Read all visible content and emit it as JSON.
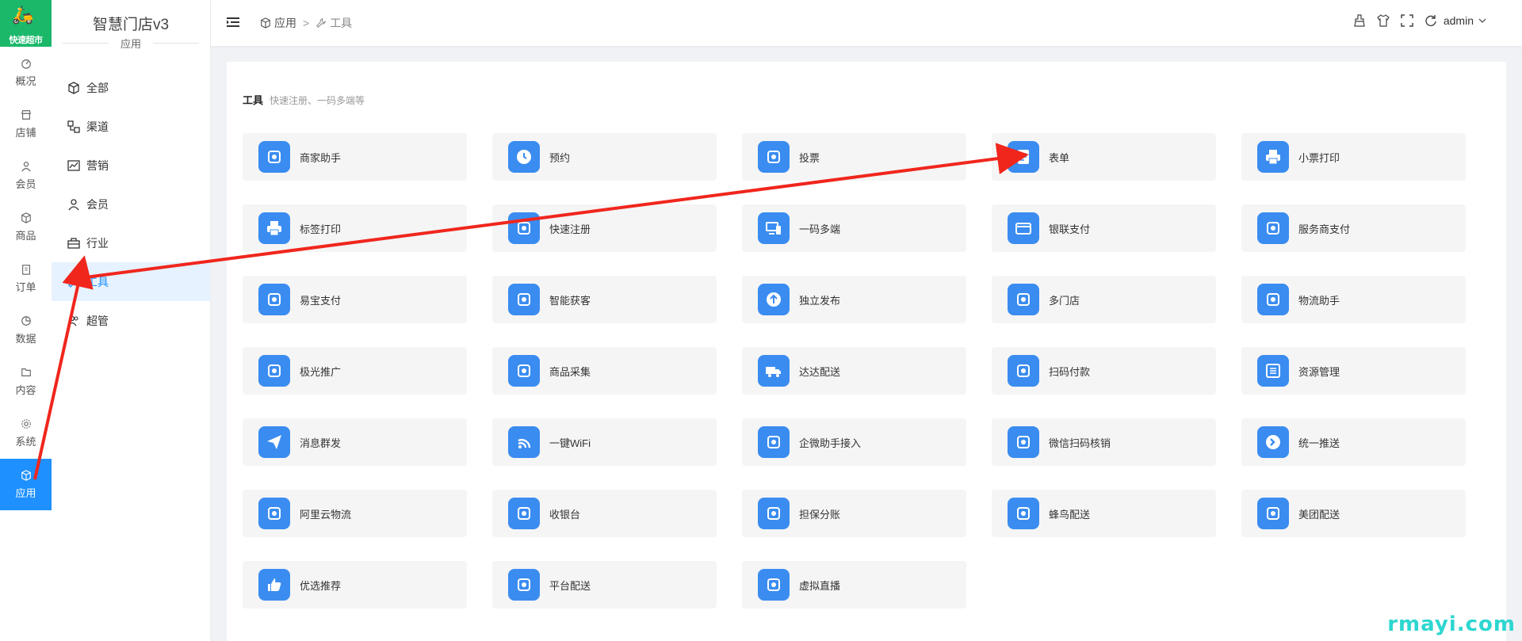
{
  "logo": {
    "mark": "🛵",
    "text": "快速超市"
  },
  "rail": [
    {
      "label": "概况",
      "icon": "dashboard-icon"
    },
    {
      "label": "店铺",
      "icon": "shop-icon"
    },
    {
      "label": "会员",
      "icon": "user-icon"
    },
    {
      "label": "商品",
      "icon": "box-icon"
    },
    {
      "label": "订单",
      "icon": "clipboard-icon"
    },
    {
      "label": "数据",
      "icon": "pie-icon"
    },
    {
      "label": "内容",
      "icon": "folder-icon"
    },
    {
      "label": "系统",
      "icon": "gear-icon"
    },
    {
      "label": "应用",
      "icon": "cube-icon",
      "active": true
    }
  ],
  "sidebar": {
    "title": "智慧门店v3",
    "subtitle": "应用",
    "items": [
      {
        "label": "全部",
        "icon": "cube-icon"
      },
      {
        "label": "渠道",
        "icon": "channel-icon"
      },
      {
        "label": "营销",
        "icon": "chart-icon"
      },
      {
        "label": "会员",
        "icon": "user-icon"
      },
      {
        "label": "行业",
        "icon": "briefcase-icon"
      },
      {
        "label": "工具",
        "icon": "wrench-icon",
        "active": true
      },
      {
        "label": "超管",
        "icon": "users-icon"
      }
    ]
  },
  "header": {
    "breadcrumb": [
      "应用",
      "工具"
    ],
    "breadcrumb_sep": ">",
    "user": "admin"
  },
  "content": {
    "title": "工具",
    "subtitle": "快速注册、一码多端等",
    "apps": [
      {
        "label": "商家助手",
        "icon": "app-phone-icon"
      },
      {
        "label": "预约",
        "icon": "clock-icon"
      },
      {
        "label": "投票",
        "icon": "ballot-icon"
      },
      {
        "label": "表单",
        "icon": "form-icon"
      },
      {
        "label": "小票打印",
        "icon": "receipt-printer-icon"
      },
      {
        "label": "标签打印",
        "icon": "printer-icon"
      },
      {
        "label": "快速注册",
        "icon": "user-add-icon"
      },
      {
        "label": "一码多端",
        "icon": "devices-icon"
      },
      {
        "label": "银联支付",
        "icon": "card-icon"
      },
      {
        "label": "服务商支付",
        "icon": "wallet-icon"
      },
      {
        "label": "易宝支付",
        "icon": "yeepay-icon"
      },
      {
        "label": "智能获客",
        "icon": "users-icon"
      },
      {
        "label": "独立发布",
        "icon": "upload-icon"
      },
      {
        "label": "多门店",
        "icon": "store-icon"
      },
      {
        "label": "物流助手",
        "icon": "logistics-icon"
      },
      {
        "label": "极光推广",
        "icon": "aurora-icon"
      },
      {
        "label": "商品采集",
        "icon": "collect-icon"
      },
      {
        "label": "达达配送",
        "icon": "truck-icon"
      },
      {
        "label": "扫码付款",
        "icon": "barcode-icon"
      },
      {
        "label": "资源管理",
        "icon": "list-icon"
      },
      {
        "label": "消息群发",
        "icon": "send-icon"
      },
      {
        "label": "一键WiFi",
        "icon": "wifi-icon"
      },
      {
        "label": "企微助手接入",
        "icon": "wecom-icon"
      },
      {
        "label": "微信扫码核销",
        "icon": "wechat-icon"
      },
      {
        "label": "统一推送",
        "icon": "arrow-right-icon"
      },
      {
        "label": "阿里云物流",
        "icon": "aliyun-icon"
      },
      {
        "label": "收银台",
        "icon": "cashier-icon"
      },
      {
        "label": "担保分账",
        "icon": "split-icon"
      },
      {
        "label": "蜂鸟配送",
        "icon": "bird-icon"
      },
      {
        "label": "美团配送",
        "icon": "meituan-icon"
      },
      {
        "label": "优选推荐",
        "icon": "thumbs-up-icon"
      },
      {
        "label": "平台配送",
        "icon": "monitor-truck-icon"
      },
      {
        "label": "虚拟直播",
        "icon": "live-icon"
      }
    ]
  },
  "watermark": "rmayi.com",
  "colors": {
    "accent": "#1e90ff",
    "icon_bg": "#3a8cf0",
    "card_bg": "#f5f5f5",
    "logo_bg": "#1bb86a",
    "arrow": "#f0261d"
  }
}
